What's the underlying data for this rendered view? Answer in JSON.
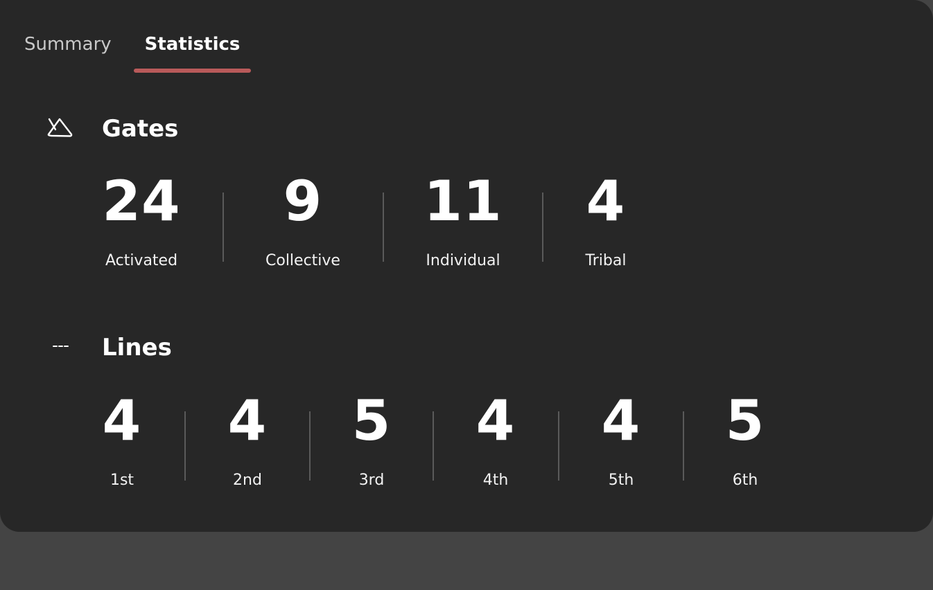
{
  "tabs": [
    {
      "label": "Summary",
      "active": false
    },
    {
      "label": "Statistics",
      "active": true
    }
  ],
  "accent_color": "#b95a5a",
  "gates": {
    "icon": "triangle-icon",
    "title": "Gates",
    "stats": [
      {
        "value": "24",
        "label": "Activated"
      },
      {
        "value": "9",
        "label": "Collective"
      },
      {
        "value": "11",
        "label": "Individual"
      },
      {
        "value": "4",
        "label": "Tribal"
      }
    ]
  },
  "lines": {
    "icon": "dashed-line-icon",
    "title": "Lines",
    "stats": [
      {
        "value": "4",
        "label": "1st"
      },
      {
        "value": "4",
        "label": "2nd"
      },
      {
        "value": "5",
        "label": "3rd"
      },
      {
        "value": "4",
        "label": "4th"
      },
      {
        "value": "4",
        "label": "5th"
      },
      {
        "value": "5",
        "label": "6th"
      }
    ]
  }
}
